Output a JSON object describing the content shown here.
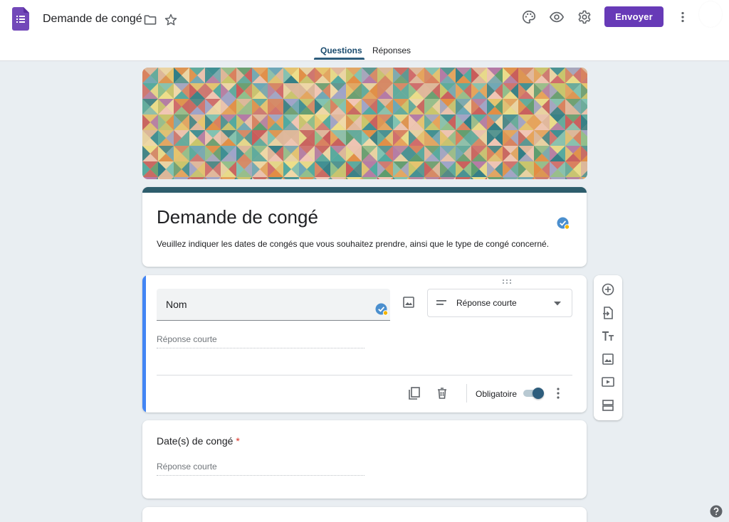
{
  "header": {
    "title": "Demande de congé",
    "send_label": "Envoyer",
    "icons": [
      "forms-logo-icon",
      "folder-icon",
      "star-icon",
      "palette-icon",
      "preview-eye-icon",
      "settings-gear-icon",
      "more-vert-icon"
    ]
  },
  "tabs": [
    {
      "label": "Questions",
      "active": true
    },
    {
      "label": "Réponses",
      "active": false
    }
  ],
  "form": {
    "title": "Demande de congé",
    "description": "Veuillez indiquer les dates de congés que vous souhaitez prendre, ainsi que le type de congé concerné."
  },
  "question1": {
    "title": "Nom",
    "type_label": "Réponse courte",
    "answer_placeholder": "Réponse courte",
    "required_label": "Obligatoire",
    "required": true
  },
  "question2": {
    "title": "Date(s) de congé",
    "required_mark": "*",
    "answer_placeholder": "Réponse courte"
  },
  "toolbar": {
    "icons": [
      "add-question-icon",
      "import-questions-icon",
      "add-title-icon",
      "add-image-icon",
      "add-video-icon",
      "add-section-icon"
    ]
  },
  "colors": {
    "accent": "#673ab7",
    "theme": "#2e5d7c",
    "active_question_bar": "#4285f4",
    "background": "#e9eef2"
  }
}
